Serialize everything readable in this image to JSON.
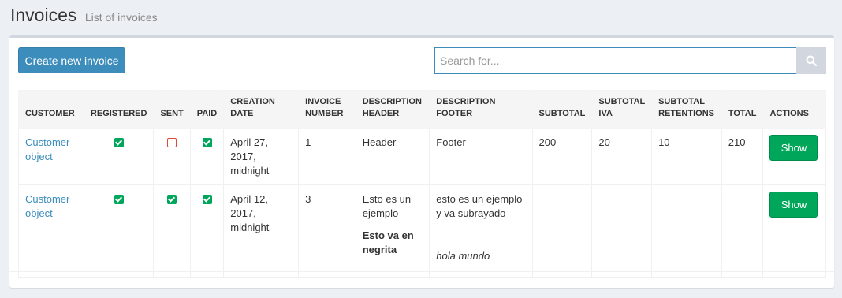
{
  "header": {
    "title": "Invoices",
    "subtitle": "List of invoices"
  },
  "toolbar": {
    "create_label": "Create new invoice",
    "search_placeholder": "Search for...",
    "search_value": "",
    "search_icon": "search-icon"
  },
  "table": {
    "columns": [
      "CUSTOMER",
      "REGISTERED",
      "SENT",
      "PAID",
      "CREATION DATE",
      "INVOICE NUMBER",
      "DESCRIPTION HEADER",
      "DESCRIPTION FOOTER",
      "SUBTOTAL",
      "SUBTOTAL IVA",
      "SUBTOTAL RETENTIONS",
      "TOTAL",
      "ACTIONS"
    ],
    "rows": [
      {
        "customer": "Customer object",
        "registered": true,
        "sent": false,
        "paid": true,
        "creation_date": "April 27, 2017, midnight",
        "invoice_number": "1",
        "description_header": [
          "Header"
        ],
        "description_header_bold": "",
        "description_footer": "Footer",
        "description_footer_italic": "",
        "subtotal": "200",
        "subtotal_iva": "20",
        "subtotal_retentions": "10",
        "total": "210",
        "action_label": "Show"
      },
      {
        "customer": "Customer object",
        "registered": true,
        "sent": true,
        "paid": true,
        "creation_date": "April 12, 2017, midnight",
        "invoice_number": "3",
        "description_header": [
          "Esto es un ejemplo"
        ],
        "description_header_bold": "Esto va en negrita",
        "description_footer": "esto es un ejemplo y va subrayado",
        "description_footer_italic": "hola mundo",
        "subtotal": "",
        "subtotal_iva": "",
        "subtotal_retentions": "",
        "total": "",
        "action_label": "Show"
      }
    ]
  },
  "colors": {
    "primary": "#3c8dbc",
    "success": "#00a65a",
    "danger": "#dd4b39",
    "background": "#ecf0f5"
  }
}
